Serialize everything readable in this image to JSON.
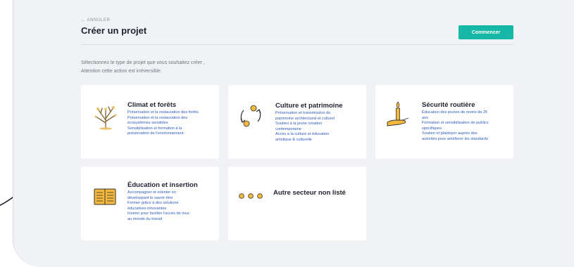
{
  "header": {
    "back_label": "← ANNULER",
    "title": "Créer un projet",
    "start_label": "Commencer"
  },
  "intro": {
    "line1": "Sélectionnez le type de projet que vous souhaitez créer ,",
    "line2": "Attention cette action est irréversible."
  },
  "cards": [
    {
      "title": "Climat et forêts",
      "icon": "tree-icon",
      "lines": [
        "Préservation et la restauration des forêts",
        "Préservation et la restauration des",
        "écosystèmes sensibles",
        "Sensibilisation et formation à la",
        "préservation de l'environnement"
      ]
    },
    {
      "title": "Culture et patrimoine",
      "icon": "circular-arrows-icon",
      "lines": [
        "Préservation et transmission du",
        "patrimoine architectural et culturel",
        "Soutien à la jeune création",
        "contemporaine",
        "Accès à la culture et éducation",
        "artistique & culturelle"
      ]
    },
    {
      "title": "Sécurité routière",
      "icon": "hand-candle-icon",
      "lines": [
        "Éducation des jeunes de moins de 25",
        "ans",
        "Formation et sensibilisation de publics",
        "spécifiques",
        "Soutien et plaidoyer auprès des",
        "autorités pour améliorer les standards"
      ]
    },
    {
      "title": "Éducation et insertion",
      "icon": "open-book-icon",
      "lines": [
        "Accompagner et orienter en",
        "développant le savoir-être",
        "Former grâce à des solutions",
        "éducatives innovantes",
        "Insérer pour faciliter l'accès de tous",
        "au monde du travail"
      ]
    },
    {
      "title": "Autre secteur non listé",
      "icon": "three-dots-icon",
      "lines": []
    }
  ],
  "colors": {
    "accent": "#17b8a6",
    "icon_yellow": "#f3b83c",
    "link_blue": "#2f5ab8"
  }
}
